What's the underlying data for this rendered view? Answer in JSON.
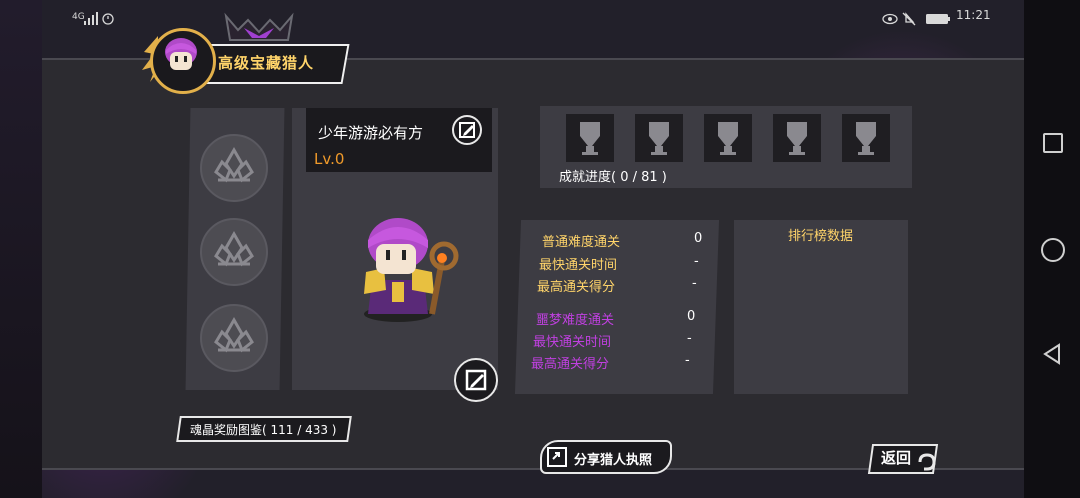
{
  "status_bar": {
    "network": "4G",
    "time": "11:21"
  },
  "header": {
    "title": "高级宝藏猎人"
  },
  "character": {
    "name": "少年游游必有方",
    "level": "Lv.0"
  },
  "achievements": {
    "progress": "成就进度( 0 / 81 )",
    "slot_count": 5
  },
  "stats": {
    "normal": {
      "difficulty_label": "普通难度通关",
      "clears": "0",
      "fastest_label": "最快通关时间",
      "fastest": "-",
      "highscore_label": "最高通关得分",
      "highscore": "-"
    },
    "nightmare": {
      "difficulty_label": "噩梦难度通关",
      "clears": "0",
      "fastest_label": "最快通关时间",
      "fastest": "-",
      "highscore_label": "最高通关得分",
      "highscore": "-"
    }
  },
  "leaderboard": {
    "title": "排行榜数据"
  },
  "crystal": {
    "label": "魂晶奖励图鉴( 111 / 433 )"
  },
  "buttons": {
    "share": "分享猎人执照",
    "back": "返回"
  },
  "colors": {
    "gold": "#ffd46a",
    "purple": "#c040e0",
    "orange": "#f09a2a"
  }
}
